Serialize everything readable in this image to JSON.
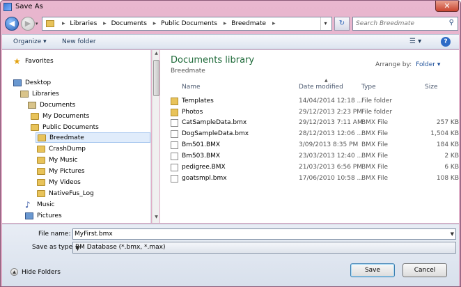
{
  "window": {
    "title": "Save As"
  },
  "address": {
    "crumbs": [
      "Libraries",
      "Documents",
      "Public Documents",
      "Breedmate"
    ],
    "separator": "▸",
    "search_placeholder": "Search Breedmate"
  },
  "toolbar": {
    "organize": "Organize ▾",
    "new_folder": "New folder"
  },
  "nav": {
    "items": [
      {
        "label": "Favorites",
        "icon": "star-icon"
      },
      {
        "label": "Desktop",
        "icon": "desktop-icon"
      },
      {
        "label": "Libraries",
        "icon": "library-icon"
      },
      {
        "label": "Documents",
        "icon": "documents-icon"
      },
      {
        "label": "My Documents",
        "icon": "folder-icon"
      },
      {
        "label": "Public Documents",
        "icon": "folder-icon"
      },
      {
        "label": "Breedmate",
        "icon": "folder-icon",
        "selected": true
      },
      {
        "label": "CrashDump",
        "icon": "locked-folder-icon"
      },
      {
        "label": "My Music",
        "icon": "locked-folder-icon"
      },
      {
        "label": "My Pictures",
        "icon": "locked-folder-icon"
      },
      {
        "label": "My Videos",
        "icon": "locked-folder-icon"
      },
      {
        "label": "NativeFus_Log",
        "icon": "locked-folder-icon"
      },
      {
        "label": "Music",
        "icon": "music-icon"
      },
      {
        "label": "Pictures",
        "icon": "pictures-icon"
      }
    ]
  },
  "main": {
    "library_title": "Documents library",
    "library_subtitle": "Breedmate",
    "arrange_label": "Arrange by:",
    "arrange_value": "Folder ▾",
    "columns": {
      "name": "Name",
      "date": "Date modified",
      "type": "Type",
      "size": "Size"
    },
    "files": [
      {
        "name": "Templates",
        "date": "14/04/2014 12:18 ...",
        "type": "File folder",
        "size": "",
        "kind": "folder"
      },
      {
        "name": "Photos",
        "date": "29/12/2013 2:23 PM",
        "type": "File folder",
        "size": "",
        "kind": "folder"
      },
      {
        "name": "CatSampleData.bmx",
        "date": "29/12/2013 7:11 AM",
        "type": "BMX File",
        "size": "257 KB",
        "kind": "file"
      },
      {
        "name": "DogSampleData.bmx",
        "date": "28/12/2013 12:06 ...",
        "type": "BMX File",
        "size": "1,504 KB",
        "kind": "file"
      },
      {
        "name": "Bm501.BMX",
        "date": "3/09/2013 8:35 PM",
        "type": "BMX File",
        "size": "184 KB",
        "kind": "file"
      },
      {
        "name": "Bm503.BMX",
        "date": "23/03/2013 12:40 ...",
        "type": "BMX File",
        "size": "2 KB",
        "kind": "file"
      },
      {
        "name": "pedigree.BMX",
        "date": "21/03/2013 6:56 PM",
        "type": "BMX File",
        "size": "6 KB",
        "kind": "file"
      },
      {
        "name": "goatsmpl.bmx",
        "date": "17/06/2010 10:58 ...",
        "type": "BMX File",
        "size": "108 KB",
        "kind": "file"
      }
    ]
  },
  "form": {
    "file_name_label": "File name:",
    "file_name_value": "MyFirst.bmx",
    "save_type_label": "Save as type:",
    "save_type_value": "BM Database (*.bmx, *.max)",
    "hide_folders": "Hide Folders",
    "save_button": "Save",
    "cancel_button": "Cancel"
  }
}
